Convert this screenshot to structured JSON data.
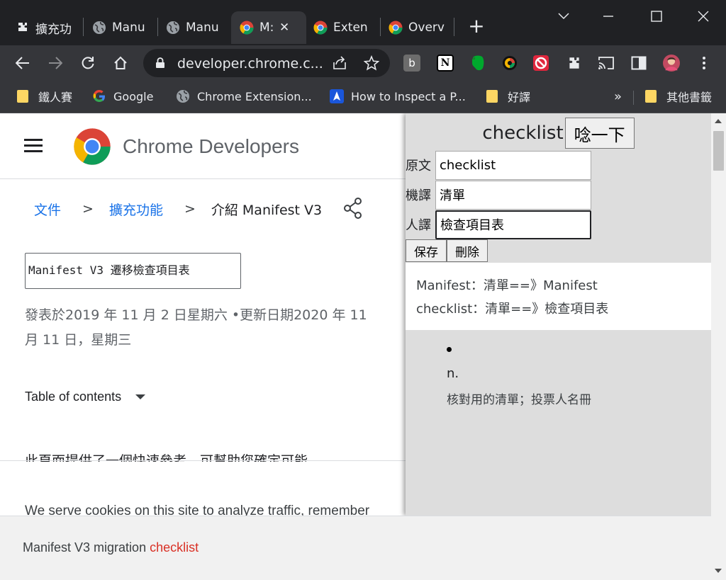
{
  "tabs": [
    {
      "title": "擴充功",
      "icon": "puzzle-icon"
    },
    {
      "title": "Manu",
      "icon": "globe-icon"
    },
    {
      "title": "Manu",
      "icon": "globe-icon"
    },
    {
      "title": "M:",
      "icon": "chrome-icon",
      "active": true,
      "close": "✕"
    },
    {
      "title": "Exten",
      "icon": "chrome-icon"
    },
    {
      "title": "Overv",
      "icon": "chrome-icon"
    }
  ],
  "new_tab": "+",
  "toolbar": {
    "url": "developer.chrome.c...",
    "extension_b_label": "b",
    "extension_n_label": "N"
  },
  "bookmarks": {
    "items": [
      "鐵人賽",
      "Google",
      "Chrome Extension...",
      "How to Inspect a P...",
      "好譯"
    ],
    "more": "»",
    "other": "其他書籤"
  },
  "page": {
    "site_title": "Chrome Developers",
    "breadcrumb": [
      "文件",
      "擴充功能",
      "介紹 Manifest V3"
    ],
    "crumb_sep": ">",
    "doc_title": "Manifest V3 遷移檢查項目表",
    "pub_date": "發表於2019 年 11 月 2 日星期六 •更新日期2020 年 11 月 11 日，星期三",
    "toc": "Table of contents",
    "intro": "此頁面提供了一個快速參考，可幫助您確定可能",
    "cookie": "We serve cookies on this site to analyze traffic, remember"
  },
  "bottom_bar": {
    "prefix": "Manifest V3 migration ",
    "highlight": "checklist"
  },
  "popup": {
    "word": "checklist",
    "lookup_button": "唸一下",
    "rows": [
      {
        "label": "原文",
        "value": "checklist"
      },
      {
        "label": "機譯",
        "value": "清單"
      },
      {
        "label": "人譯",
        "value": "檢查項目表"
      }
    ],
    "save_button": "保存",
    "delete_button": "刪除",
    "saved": [
      "Manifest：清單==》Manifest",
      "checklist：清單==》檢查項目表"
    ],
    "definition": {
      "pos": "n.",
      "text": "核對用的清單；投票人名冊"
    }
  },
  "colors": {
    "chrome_dark": "#202124",
    "toolbar": "#35363a",
    "link_blue": "#1a73e8",
    "highlight_red": "#d93025",
    "popup_bg": "#dddddd"
  }
}
